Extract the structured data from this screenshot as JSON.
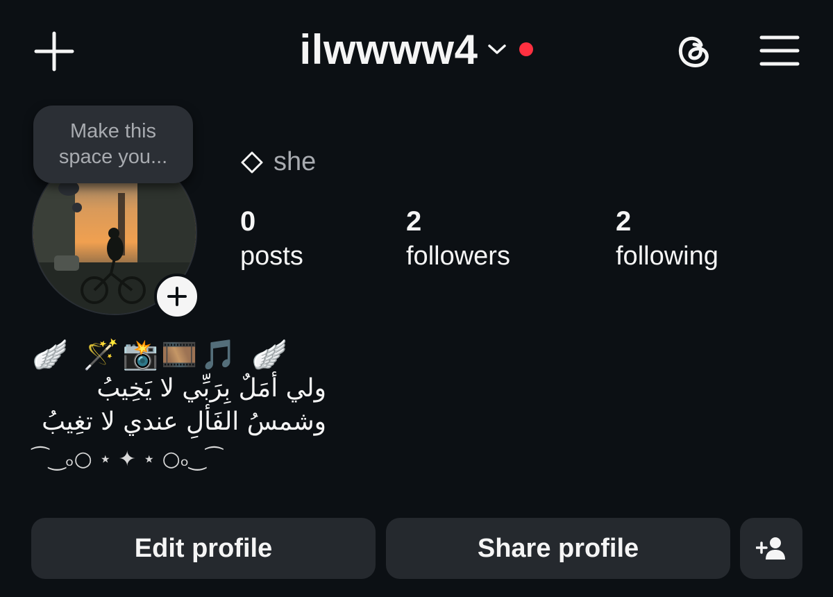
{
  "header": {
    "username": "ilwwww4",
    "icons": {
      "add": "plus-icon",
      "dropdown": "chevron-down-icon",
      "notification": "red-dot",
      "threads": "threads-icon",
      "menu": "hamburger-menu-icon"
    },
    "notification_color": "#ff3040"
  },
  "note": {
    "text": "Make this space you..."
  },
  "profile": {
    "pronouns": "she",
    "pronoun_icon": "diamond-outline-icon",
    "stats": {
      "posts_count": "0",
      "posts_label": "posts",
      "followers_count": "2",
      "followers_label": "followers",
      "following_count": "2",
      "following_label": "following"
    }
  },
  "bio": {
    "emoji_line": "🪽 🪄📸🎞️🎵 🪽",
    "line1": "ولي أمَلٌ بِرَبِّي لا يَخِيبُ",
    "line2": "وشمسُ الفَألِ عندي لا تغِيبُ",
    "decoration": "⁀‿ₒ○ ⋆ ✦ ⋆ ○ₒ‿⁀"
  },
  "actions": {
    "edit_label": "Edit profile",
    "share_label": "Share profile",
    "discover_icon": "add-person-icon"
  },
  "colors": {
    "background": "#0c1014",
    "button_bg": "#25292e",
    "text": "#f5f5f5",
    "muted_text": "#a8abb0"
  }
}
